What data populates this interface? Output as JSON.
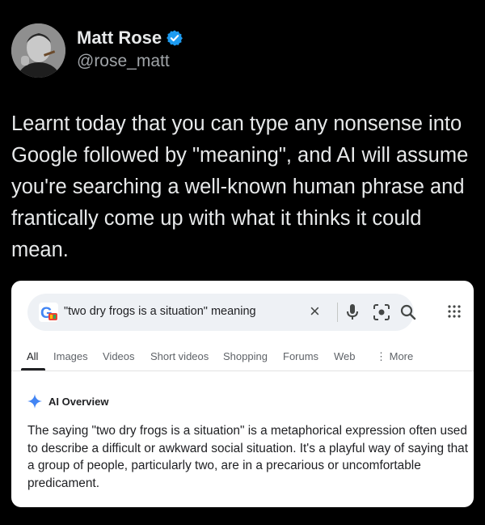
{
  "tweet": {
    "display_name": "Matt Rose",
    "handle": "@rose_matt",
    "verified_icon": "verified-badge-icon",
    "text": "Learnt today that you can type any nonsense into Google followed by \"meaning\", and AI will assume you're searching a well-known human phrase and frantically come up with what it thinks it could mean."
  },
  "search": {
    "query": "\"two dry frogs is a situation\" meaning",
    "clear_symbol": "×",
    "icons": [
      "google-logo-icon",
      "clear-icon",
      "microphone-icon",
      "lens-icon",
      "search-icon",
      "apps-grid-icon"
    ]
  },
  "tabs": [
    {
      "label": "All",
      "active": true
    },
    {
      "label": "Images"
    },
    {
      "label": "Videos"
    },
    {
      "label": "Short videos"
    },
    {
      "label": "Shopping"
    },
    {
      "label": "Forums"
    },
    {
      "label": "Web"
    },
    {
      "label": "⋮ More"
    }
  ],
  "ai_overview": {
    "label": "AI Overview",
    "text": "The saying \"two dry frogs is a situation\" is a metaphorical expression often used to describe a difficult or awkward social situation. It's a playful way of saying that a group of people, particularly two, are in a precarious or uncomfortable predicament."
  },
  "colors": {
    "background": "#000000",
    "verified": "#1d9bf0",
    "ai_spark": "#4285f4"
  }
}
